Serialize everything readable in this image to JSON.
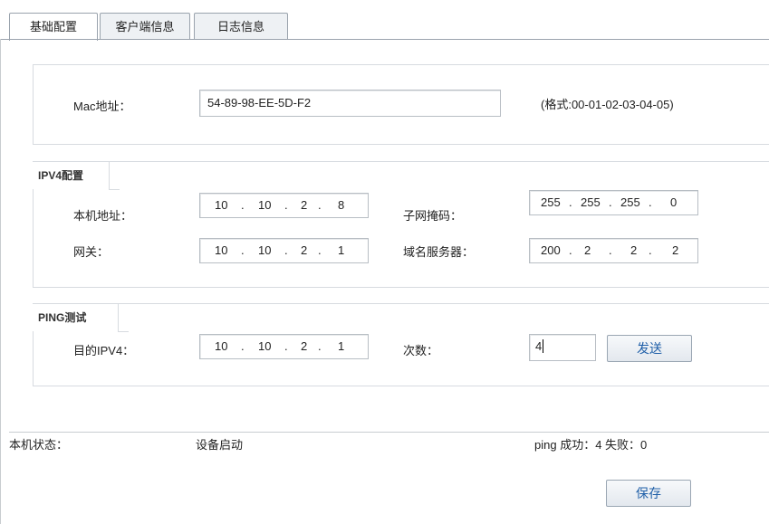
{
  "tabs": [
    "基础配置",
    "客户端信息",
    "日志信息"
  ],
  "mac": {
    "label": "Mac地址：",
    "value": "54-89-98-EE-5D-F2",
    "hint": "(格式:00-01-02-03-04-05)"
  },
  "ipv4": {
    "title": "IPV4配置",
    "local_label": "本机地址：",
    "local_ip": [
      "10",
      "10",
      "2",
      "8"
    ],
    "mask_label": "子网掩码：",
    "mask": [
      "255",
      "255",
      "255",
      "0"
    ],
    "gateway_label": "网关：",
    "gateway": [
      "10",
      "10",
      "2",
      "1"
    ],
    "dns_label": "域名服务器：",
    "dns": [
      "200",
      "2",
      "2",
      "2"
    ]
  },
  "ping": {
    "title": "PING测试",
    "target_label": "目的IPV4：",
    "target": [
      "10",
      "10",
      "2",
      "1"
    ],
    "count_label": "次数：",
    "count_value": "4",
    "send_button": "发送"
  },
  "status": {
    "label": "本机状态：",
    "value": "设备启动",
    "ping_result": "ping 成功：4    失败：0"
  },
  "save_button": "保存"
}
